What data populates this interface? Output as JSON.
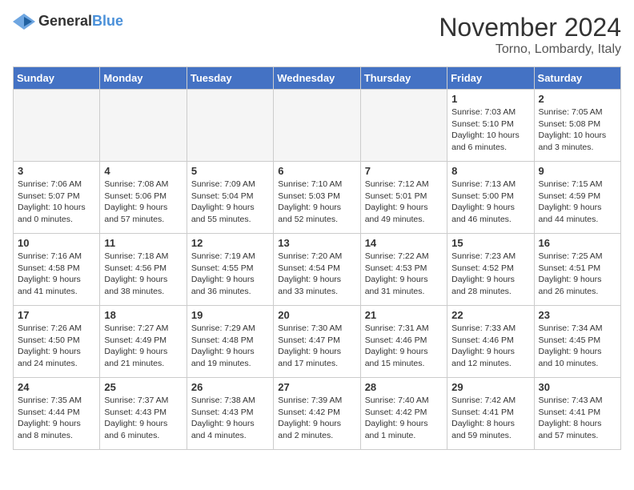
{
  "header": {
    "logo_general": "General",
    "logo_blue": "Blue",
    "month_title": "November 2024",
    "location": "Torno, Lombardy, Italy"
  },
  "days_of_week": [
    "Sunday",
    "Monday",
    "Tuesday",
    "Wednesday",
    "Thursday",
    "Friday",
    "Saturday"
  ],
  "weeks": [
    [
      {
        "day": "",
        "info": ""
      },
      {
        "day": "",
        "info": ""
      },
      {
        "day": "",
        "info": ""
      },
      {
        "day": "",
        "info": ""
      },
      {
        "day": "",
        "info": ""
      },
      {
        "day": "1",
        "info": "Sunrise: 7:03 AM\nSunset: 5:10 PM\nDaylight: 10 hours and 6 minutes."
      },
      {
        "day": "2",
        "info": "Sunrise: 7:05 AM\nSunset: 5:08 PM\nDaylight: 10 hours and 3 minutes."
      }
    ],
    [
      {
        "day": "3",
        "info": "Sunrise: 7:06 AM\nSunset: 5:07 PM\nDaylight: 10 hours and 0 minutes."
      },
      {
        "day": "4",
        "info": "Sunrise: 7:08 AM\nSunset: 5:06 PM\nDaylight: 9 hours and 57 minutes."
      },
      {
        "day": "5",
        "info": "Sunrise: 7:09 AM\nSunset: 5:04 PM\nDaylight: 9 hours and 55 minutes."
      },
      {
        "day": "6",
        "info": "Sunrise: 7:10 AM\nSunset: 5:03 PM\nDaylight: 9 hours and 52 minutes."
      },
      {
        "day": "7",
        "info": "Sunrise: 7:12 AM\nSunset: 5:01 PM\nDaylight: 9 hours and 49 minutes."
      },
      {
        "day": "8",
        "info": "Sunrise: 7:13 AM\nSunset: 5:00 PM\nDaylight: 9 hours and 46 minutes."
      },
      {
        "day": "9",
        "info": "Sunrise: 7:15 AM\nSunset: 4:59 PM\nDaylight: 9 hours and 44 minutes."
      }
    ],
    [
      {
        "day": "10",
        "info": "Sunrise: 7:16 AM\nSunset: 4:58 PM\nDaylight: 9 hours and 41 minutes."
      },
      {
        "day": "11",
        "info": "Sunrise: 7:18 AM\nSunset: 4:56 PM\nDaylight: 9 hours and 38 minutes."
      },
      {
        "day": "12",
        "info": "Sunrise: 7:19 AM\nSunset: 4:55 PM\nDaylight: 9 hours and 36 minutes."
      },
      {
        "day": "13",
        "info": "Sunrise: 7:20 AM\nSunset: 4:54 PM\nDaylight: 9 hours and 33 minutes."
      },
      {
        "day": "14",
        "info": "Sunrise: 7:22 AM\nSunset: 4:53 PM\nDaylight: 9 hours and 31 minutes."
      },
      {
        "day": "15",
        "info": "Sunrise: 7:23 AM\nSunset: 4:52 PM\nDaylight: 9 hours and 28 minutes."
      },
      {
        "day": "16",
        "info": "Sunrise: 7:25 AM\nSunset: 4:51 PM\nDaylight: 9 hours and 26 minutes."
      }
    ],
    [
      {
        "day": "17",
        "info": "Sunrise: 7:26 AM\nSunset: 4:50 PM\nDaylight: 9 hours and 24 minutes."
      },
      {
        "day": "18",
        "info": "Sunrise: 7:27 AM\nSunset: 4:49 PM\nDaylight: 9 hours and 21 minutes."
      },
      {
        "day": "19",
        "info": "Sunrise: 7:29 AM\nSunset: 4:48 PM\nDaylight: 9 hours and 19 minutes."
      },
      {
        "day": "20",
        "info": "Sunrise: 7:30 AM\nSunset: 4:47 PM\nDaylight: 9 hours and 17 minutes."
      },
      {
        "day": "21",
        "info": "Sunrise: 7:31 AM\nSunset: 4:46 PM\nDaylight: 9 hours and 15 minutes."
      },
      {
        "day": "22",
        "info": "Sunrise: 7:33 AM\nSunset: 4:46 PM\nDaylight: 9 hours and 12 minutes."
      },
      {
        "day": "23",
        "info": "Sunrise: 7:34 AM\nSunset: 4:45 PM\nDaylight: 9 hours and 10 minutes."
      }
    ],
    [
      {
        "day": "24",
        "info": "Sunrise: 7:35 AM\nSunset: 4:44 PM\nDaylight: 9 hours and 8 minutes."
      },
      {
        "day": "25",
        "info": "Sunrise: 7:37 AM\nSunset: 4:43 PM\nDaylight: 9 hours and 6 minutes."
      },
      {
        "day": "26",
        "info": "Sunrise: 7:38 AM\nSunset: 4:43 PM\nDaylight: 9 hours and 4 minutes."
      },
      {
        "day": "27",
        "info": "Sunrise: 7:39 AM\nSunset: 4:42 PM\nDaylight: 9 hours and 2 minutes."
      },
      {
        "day": "28",
        "info": "Sunrise: 7:40 AM\nSunset: 4:42 PM\nDaylight: 9 hours and 1 minute."
      },
      {
        "day": "29",
        "info": "Sunrise: 7:42 AM\nSunset: 4:41 PM\nDaylight: 8 hours and 59 minutes."
      },
      {
        "day": "30",
        "info": "Sunrise: 7:43 AM\nSunset: 4:41 PM\nDaylight: 8 hours and 57 minutes."
      }
    ]
  ]
}
